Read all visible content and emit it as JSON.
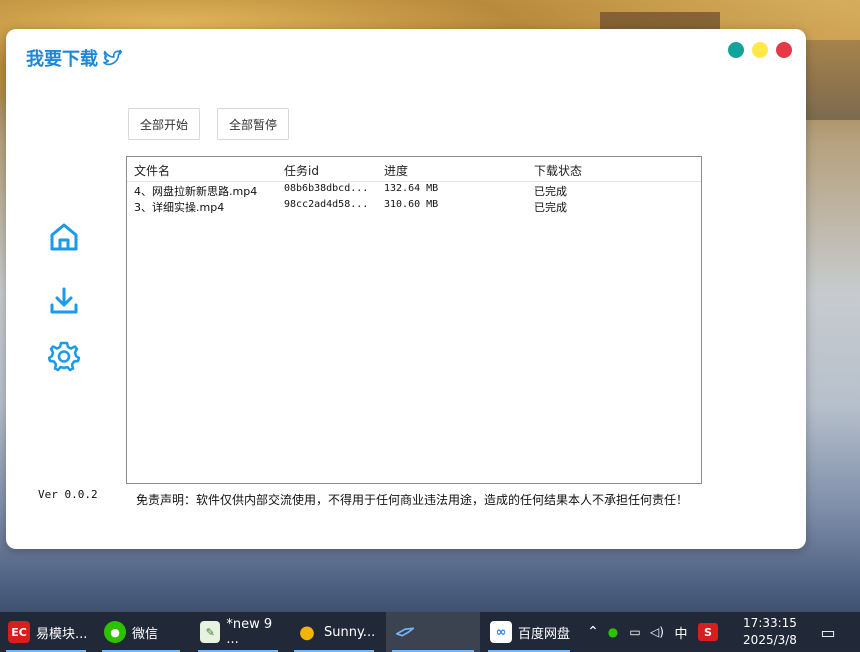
{
  "app": {
    "title": "我要下载",
    "window_dots": [
      "#12a39a",
      "#ffe84a",
      "#e63946"
    ],
    "sidebar": [
      {
        "icon": "home-icon"
      },
      {
        "icon": "download-icon"
      },
      {
        "icon": "settings-icon"
      }
    ],
    "buttons": {
      "start_all": "全部开始",
      "pause_all": "全部暂停"
    },
    "table": {
      "headers": [
        "文件名",
        "任务id",
        "进度",
        "下载状态"
      ],
      "rows": [
        {
          "name": "4、网盘拉新新思路.mp4",
          "id": "08b6b38dbcd...",
          "progress": "132.64 MB",
          "status": "已完成"
        },
        {
          "name": "3、详细实操.mp4",
          "id": "98cc2ad4d58...",
          "progress": "310.60 MB",
          "status": "已完成"
        }
      ]
    },
    "version": "Ver 0.0.2",
    "disclaimer": "免责声明：软件仅供内部交流使用，不得用于任何商业违法用途，造成的任何结果本人不承担任何责任！",
    "accent_color": "#1e88d6"
  },
  "taskbar": {
    "tasks": [
      {
        "label": "易模块...",
        "icon": "ec-icon"
      },
      {
        "label": "微信",
        "icon": "wechat-icon"
      },
      {
        "label": "*new 9 ...",
        "icon": "notepad-icon"
      },
      {
        "label": "Sunny...",
        "icon": "lightbulb-icon"
      },
      {
        "label": "",
        "icon": "bird-icon"
      },
      {
        "label": "百度网盘",
        "icon": "baidu-netdisk-icon"
      }
    ],
    "tray": {
      "ime": "中",
      "time": "17:33:15",
      "date": "2025/3/8"
    }
  }
}
